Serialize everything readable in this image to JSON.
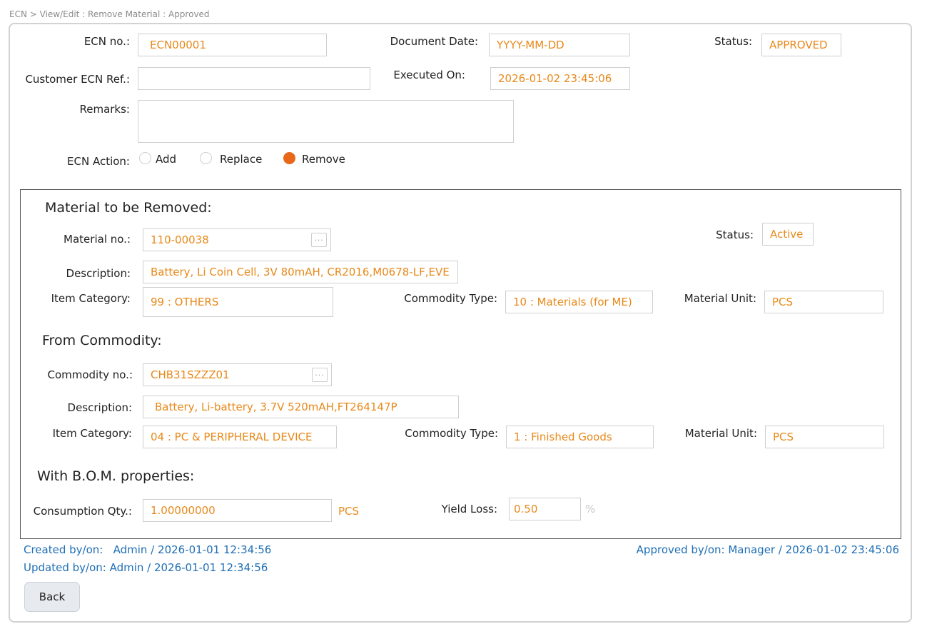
{
  "breadcrumb": "ECN > View/Edit : Remove Material : Approved",
  "header": {
    "ecn_no_label": "ECN no.:",
    "ecn_no_value": "ECN00001",
    "doc_date_label": "Document Date:",
    "doc_date_value": "YYYY-MM-DD",
    "status_label": "Status:",
    "status_value": "APPROVED",
    "cust_ref_label": "Customer ECN Ref.:",
    "cust_ref_value": "",
    "executed_label": "Executed On:",
    "executed_value": "2026-01-02 23:45:06",
    "remarks_label": "Remarks:",
    "remarks_value": "",
    "action_label": "ECN Action:",
    "actions": [
      "Add",
      "Replace",
      "Remove"
    ],
    "selected_action": "Remove"
  },
  "material": {
    "title": "Material to be Removed:",
    "no_label": "Material no.:",
    "no_value": "110-00038",
    "status_label": "Status:",
    "status_value": "Active",
    "desc_label": "Description:",
    "desc_value": "Battery, Li Coin Cell, 3V 80mAH, CR2016,M0678-LF,EVE",
    "cat_label": "Item Category:",
    "cat_value": "99 : OTHERS",
    "ctype_label": "Commodity Type:",
    "ctype_value": "10 : Materials (for ME)",
    "unit_label": "Material Unit:",
    "unit_value": "PCS"
  },
  "commodity": {
    "title": "From Commodity:",
    "no_label": "Commodity no.:",
    "no_value": "CHB31SZZZ01",
    "desc_label": "Description:",
    "desc_value": "Battery, Li-battery, 3.7V 520mAH,FT264147P",
    "cat_label": "Item Category:",
    "cat_value": "04 : PC & PERIPHERAL DEVICE",
    "ctype_label": "Commodity Type:",
    "ctype_value": "1 : Finished Goods",
    "unit_label": "Material Unit:",
    "unit_value": "PCS"
  },
  "bom": {
    "title": "With B.O.M. properties:",
    "qty_label": "Consumption Qty.:",
    "qty_value": "1.00000000",
    "qty_unit": "PCS",
    "yield_label": "Yield Loss:",
    "yield_value": "0.50",
    "yield_unit": "%"
  },
  "footer": {
    "created": "Created by/on:   Admin / 2026-01-01 12:34:56",
    "updated": "Updated by/on: Admin / 2026-01-01 12:34:56",
    "approved": "Approved by/on: Manager / 2026-01-02 23:45:06",
    "back_label": "Back"
  },
  "colors": {
    "value": "#e8891a",
    "selected_radio": "#e8681a",
    "meta_link": "#1f6fb5"
  }
}
